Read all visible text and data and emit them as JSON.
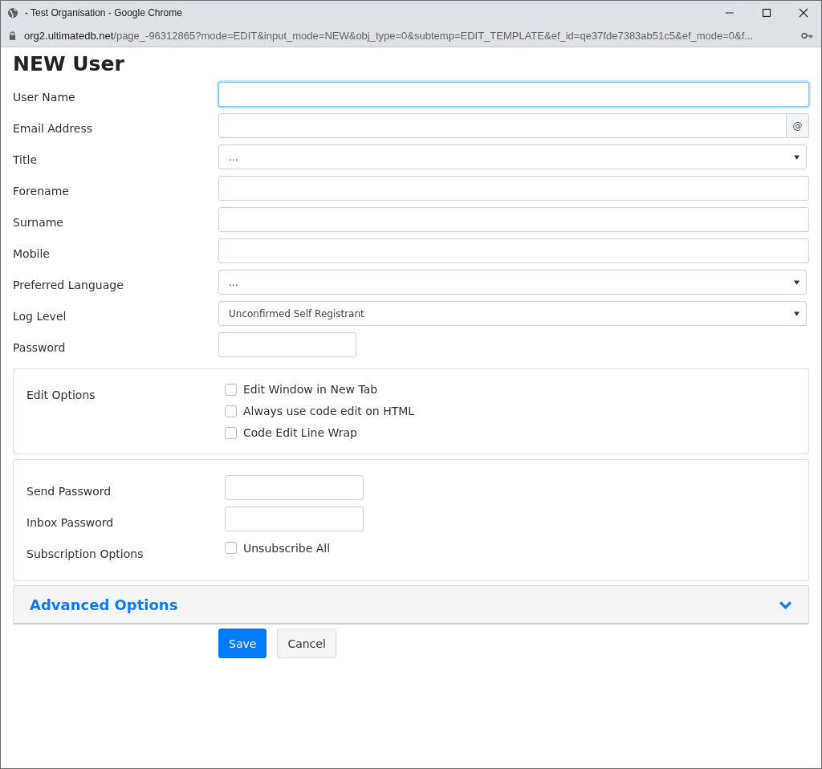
{
  "window": {
    "title": "- Test Organisation - Google Chrome"
  },
  "address_bar": {
    "url": "org2.ultimatedb.net/page_-96312865?mode=EDIT&input_mode=NEW&obj_type=0&subtemp=EDIT_TEMPLATE&ef_id=qe37fde7383ab51c5&ef_mode=0&f..."
  },
  "heading": "NEW User",
  "fields": [
    {
      "label": "User Name",
      "kind": "text",
      "focused": true
    },
    {
      "label": "Email Address",
      "kind": "email",
      "addon": "@",
      "focused": false
    },
    {
      "label": "Title",
      "kind": "select",
      "value": "...",
      "focused": false
    },
    {
      "label": "Forename",
      "kind": "text",
      "focused": false
    },
    {
      "label": "Surname",
      "kind": "text",
      "focused": false
    },
    {
      "label": "Mobile",
      "kind": "text",
      "focused": false
    },
    {
      "label": "Preferred Language",
      "kind": "select",
      "value": "...",
      "focused": false
    },
    {
      "label": "Log Level",
      "kind": "select",
      "value": "Unconfirmed Self Registrant",
      "focused": false
    },
    {
      "label": "Password",
      "kind": "short",
      "focused": false
    }
  ],
  "edit_options": {
    "label": "Edit Options",
    "checkboxes": [
      {
        "label": "Edit Window in New Tab",
        "checked": false
      },
      {
        "label": "Always use code edit on HTML",
        "checked": false
      },
      {
        "label": "Code Edit Line Wrap",
        "checked": false
      }
    ]
  },
  "mail_panel": {
    "fields": [
      {
        "label": "Send Password",
        "kind": "short"
      },
      {
        "label": "Inbox Password",
        "kind": "short"
      },
      {
        "label": "Subscription Options",
        "kind": "checkbox",
        "option": "Unsubscribe All",
        "checked": false
      }
    ]
  },
  "advanced": {
    "title": "Advanced Options",
    "expanded": false
  },
  "buttons": [
    {
      "label": "Save",
      "kind": "primary"
    },
    {
      "label": "Cancel",
      "kind": "secondary"
    }
  ]
}
